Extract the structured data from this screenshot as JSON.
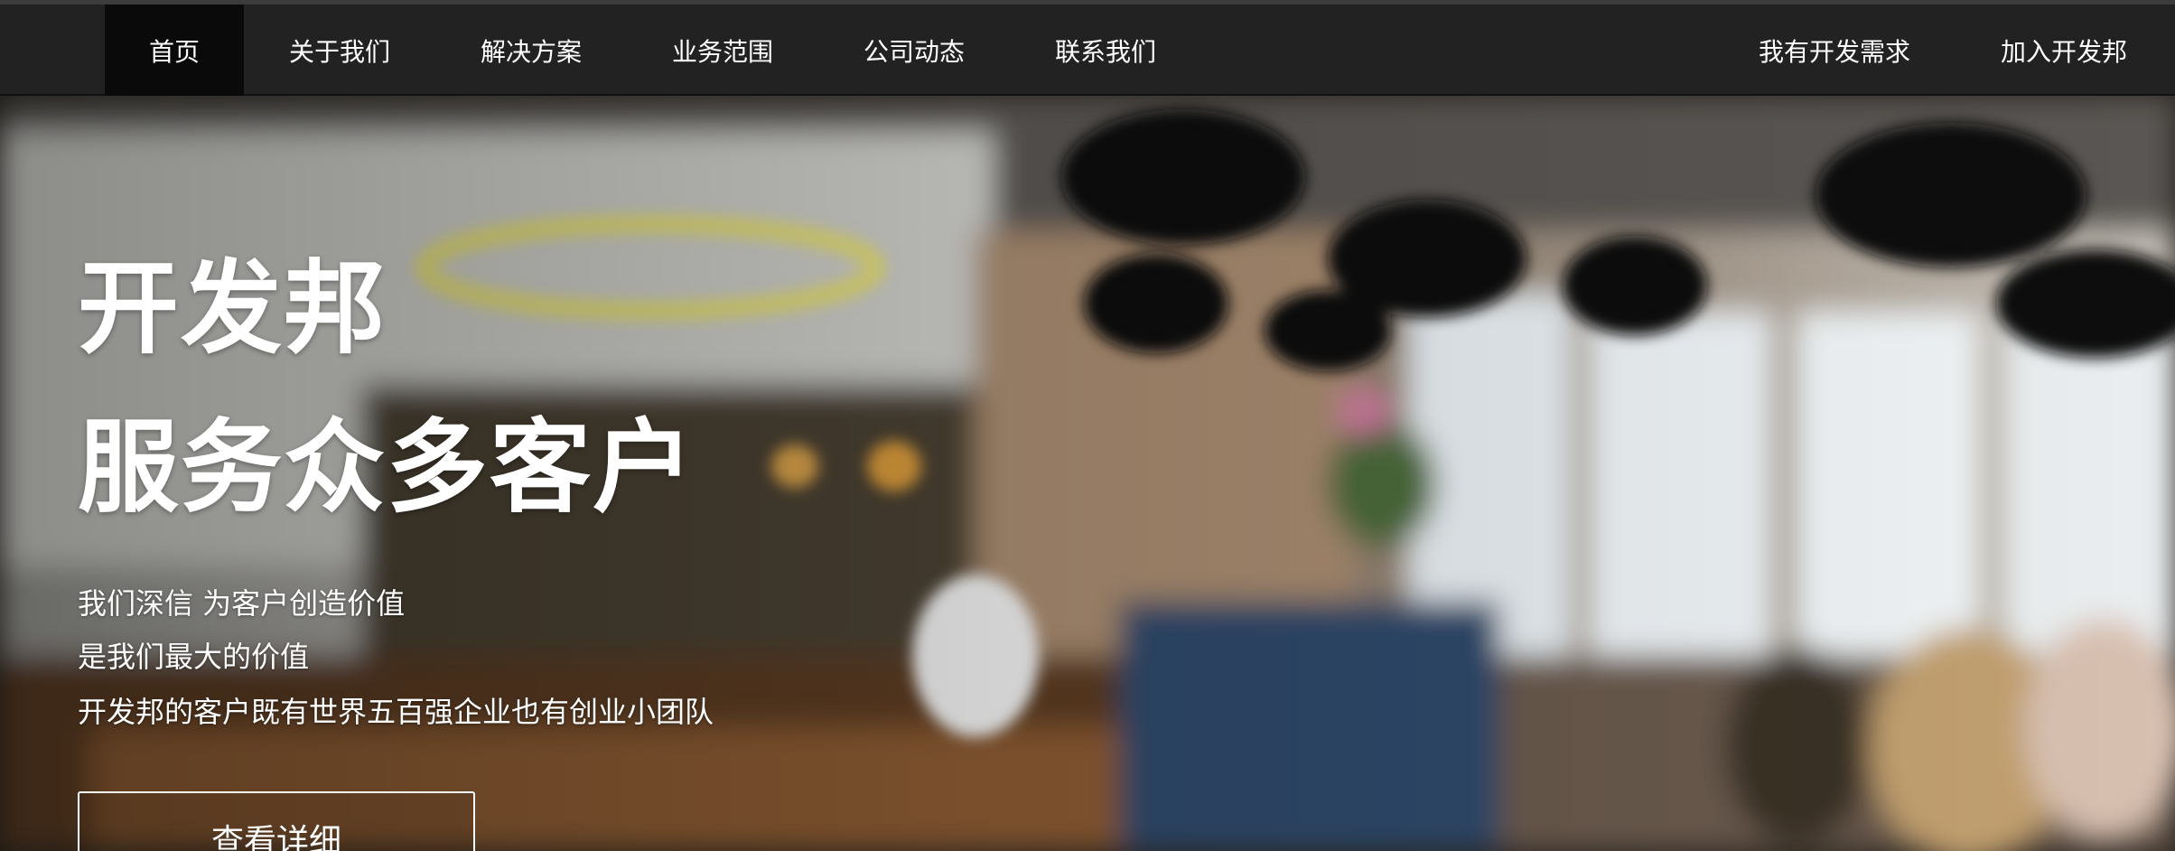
{
  "nav": {
    "left_items": [
      {
        "label": "首页",
        "active": true
      },
      {
        "label": "关于我们",
        "active": false
      },
      {
        "label": "解决方案",
        "active": false
      },
      {
        "label": "业务范围",
        "active": false
      },
      {
        "label": "公司动态",
        "active": false
      },
      {
        "label": "联系我们",
        "active": false
      }
    ],
    "right_items": [
      {
        "label": "我有开发需求"
      },
      {
        "label": "加入开发邦"
      }
    ]
  },
  "hero": {
    "title_line1": "开发邦",
    "title_line2": "服务众多客户",
    "desc_line1": "我们深信 为客户创造价值",
    "desc_line2": "是我们最大的价值",
    "desc_line3": "开发邦的客户既有世界五百强企业也有创业小团队",
    "button_label": "查看详细"
  },
  "colors": {
    "nav_bg": "#222222",
    "nav_active_bg": "#0a0a0a",
    "text": "#ffffff"
  }
}
